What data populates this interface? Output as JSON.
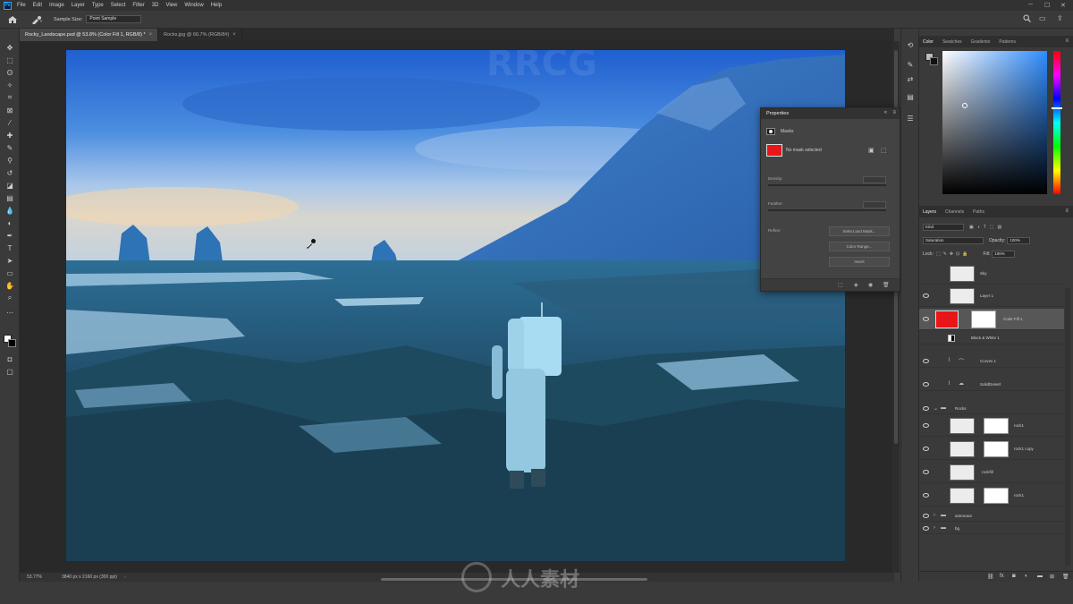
{
  "app": {
    "menu": [
      "File",
      "Edit",
      "Image",
      "Layer",
      "Type",
      "Select",
      "Filter",
      "3D",
      "View",
      "Window",
      "Help"
    ]
  },
  "options": {
    "sample_size_label": "Sample Size:",
    "sample_size_value": "Point Sample"
  },
  "tabs": [
    {
      "label": "Rocky_Landscape.psd @ 53.8% (Color Fill 1, RGB/8) *",
      "active": true
    },
    {
      "label": "Rocks.jpg @ 66.7% (RGB/8#)",
      "active": false
    }
  ],
  "status": {
    "zoom": "53.77%",
    "doc": "3840 px x 2160 px (300 ppi)"
  },
  "properties": {
    "title": "Properties",
    "section": "Masks",
    "mask_status": "No mask selected",
    "density_label": "Density:",
    "feather_label": "Feather:",
    "refine_label": "Refine:",
    "btn_select_mask": "Select and Mask...",
    "btn_color_range": "Color Range...",
    "btn_invert": "Invert"
  },
  "color_panel": {
    "tabs": [
      "Color",
      "Swatches",
      "Gradients",
      "Patterns"
    ],
    "hue_color": "#2f8cff"
  },
  "layers_panel": {
    "tabs": [
      "Layers",
      "Channels",
      "Paths"
    ],
    "kind": "Kind",
    "blend": "Saturation",
    "opacity_label": "Opacity:",
    "opacity_value": "100%",
    "lock_label": "Lock:",
    "fill_label": "Fill:",
    "fill_value": "100%",
    "layers": [
      {
        "name": "Sky",
        "kind": "pixel"
      },
      {
        "name": "Layer 1",
        "kind": "pixel"
      },
      {
        "name": "Color Fill 1",
        "kind": "fill",
        "selected": true
      },
      {
        "name": "Black & White 1",
        "kind": "adjustment"
      },
      {
        "name": "Curves 1",
        "kind": "adjustment"
      },
      {
        "name": "SolidDesert",
        "kind": "adjustment"
      },
      {
        "name": "Rocks",
        "kind": "group"
      },
      {
        "name": "rock1",
        "kind": "masked"
      },
      {
        "name": "rock1 copy",
        "kind": "masked"
      },
      {
        "name": "rockfill",
        "kind": "pixel"
      },
      {
        "name": "rock1",
        "kind": "masked"
      },
      {
        "name": "astronaut",
        "kind": "group"
      },
      {
        "name": "bg",
        "kind": "group"
      }
    ]
  },
  "watermark": {
    "brand": "RRCG",
    "site": "人人素材"
  }
}
